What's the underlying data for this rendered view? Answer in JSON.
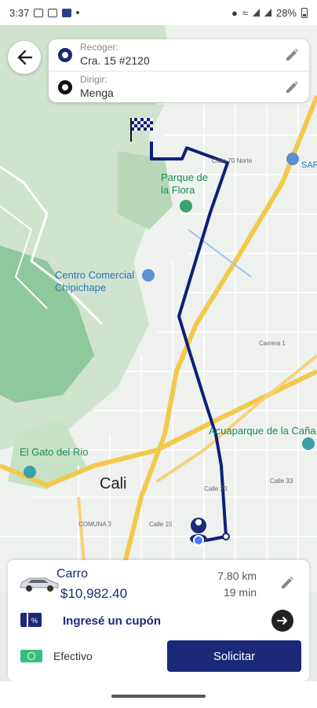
{
  "status_bar": {
    "time": "3:37",
    "battery": "28%"
  },
  "map": {
    "labels": {
      "parque": "Parque de\nla Flora",
      "centro": "Centro Comercial\nChipichape",
      "gato": "El Gato del Rio",
      "cali": "Cali",
      "acuaparque": "Acuaparque de la Caña",
      "comuna": "COMUNA 3",
      "calle23": "Calle 23",
      "calle15": "Calle 15",
      "calle33": "Calle 33",
      "carrera1": "Carrera 1",
      "norte": "Calle 70 Norte",
      "sar": "SAR"
    }
  },
  "address_card": {
    "pickup_label": "Recoger:",
    "pickup_value": "Cra. 15 #2120",
    "dest_label": "Dirigir:",
    "dest_value": "Menga"
  },
  "trip": {
    "vehicle": "Carro",
    "price": "$10,982.40",
    "distance": "7.80 km",
    "duration": "19 min"
  },
  "coupon": {
    "text": "Ingresé un cupón"
  },
  "payment": {
    "method": "Efectivo",
    "request_label": "Solicitar"
  },
  "colors": {
    "brand": "#1b2a78",
    "route": "#0f1f7a"
  }
}
